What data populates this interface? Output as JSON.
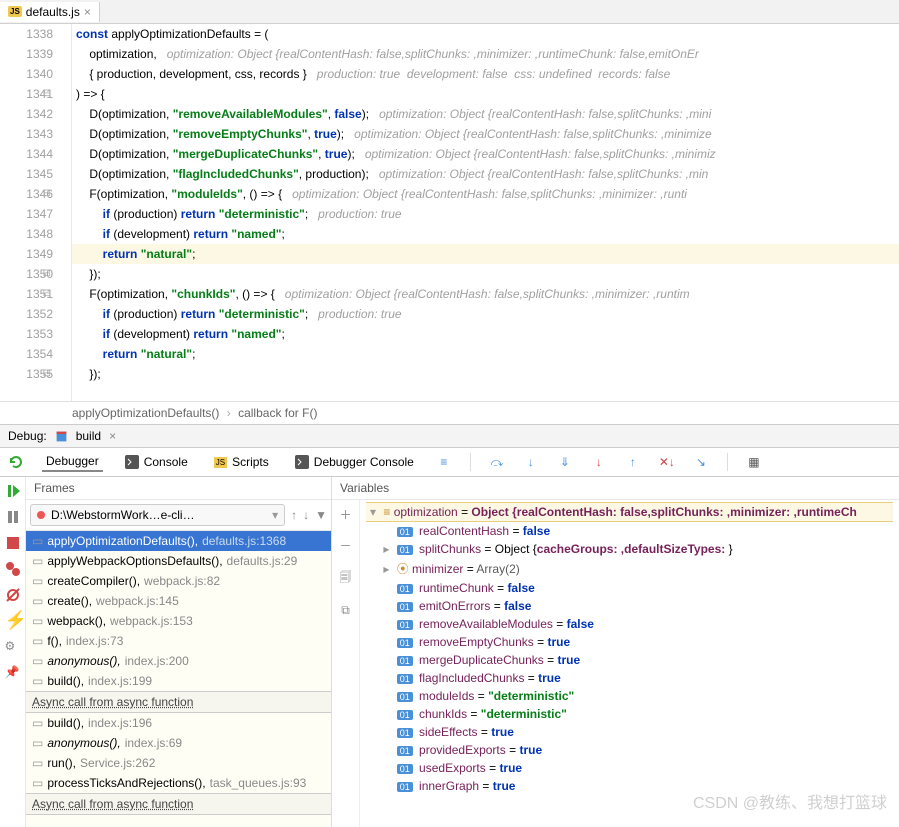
{
  "tab": {
    "label": "defaults.js"
  },
  "lines": [
    {
      "n": 1338,
      "fold": "",
      "html": "<span class='kw'>const</span> applyOptimizationDefaults = ("
    },
    {
      "n": 1339,
      "fold": "",
      "html": "    optimization,   <span class='hint'>optimization: Object {realContentHash: false,splitChunks: ,minimizer: ,runtimeChunk: false,emitOnEr</span>"
    },
    {
      "n": 1340,
      "fold": "",
      "html": "    { production, development, css, records }   <span class='hint'>production: true  development: false  css: undefined  records: false</span>"
    },
    {
      "n": 1341,
      "fold": "⊟",
      "html": ") =&gt; {"
    },
    {
      "n": 1342,
      "fold": "",
      "html": "    D(optimization, <span class='str'>\"removeAvailableModules\"</span>, <span class='lit'>false</span>);   <span class='hint'>optimization: Object {realContentHash: false,splitChunks: ,mini</span>"
    },
    {
      "n": 1343,
      "fold": "",
      "html": "    D(optimization, <span class='str'>\"removeEmptyChunks\"</span>, <span class='lit'>true</span>);   <span class='hint'>optimization: Object {realContentHash: false,splitChunks: ,minimize</span>"
    },
    {
      "n": 1344,
      "fold": "",
      "html": "    D(optimization, <span class='str'>\"mergeDuplicateChunks\"</span>, <span class='lit'>true</span>);   <span class='hint'>optimization: Object {realContentHash: false,splitChunks: ,minimiz</span>"
    },
    {
      "n": 1345,
      "fold": "",
      "html": "    D(optimization, <span class='str'>\"flagIncludedChunks\"</span>, production);   <span class='hint'>optimization: Object {realContentHash: false,splitChunks: ,min</span>"
    },
    {
      "n": 1346,
      "fold": "⊟",
      "html": "    F(optimization, <span class='str'>\"moduleIds\"</span>, () =&gt; {   <span class='hint'>optimization: Object {realContentHash: false,splitChunks: ,minimizer: ,runti</span>"
    },
    {
      "n": 1347,
      "fold": "",
      "html": "        <span class='kw'>if</span> (production) <span class='kw'>return</span> <span class='str'>\"deterministic\"</span>;   <span class='hint'>production: true</span>"
    },
    {
      "n": 1348,
      "fold": "",
      "html": "        <span class='kw'>if</span> (development) <span class='kw'>return</span> <span class='str'>\"named\"</span>;"
    },
    {
      "n": 1349,
      "fold": "",
      "hl": true,
      "html": "        <span class='kw'>return</span> <span class='str'>\"natural\"</span>;"
    },
    {
      "n": 1350,
      "fold": "⊟",
      "html": "    });"
    },
    {
      "n": 1351,
      "fold": "⊟",
      "html": "    F(optimization, <span class='str'>\"chunkIds\"</span>, () =&gt; {   <span class='hint'>optimization: Object {realContentHash: false,splitChunks: ,minimizer: ,runtim</span>"
    },
    {
      "n": 1352,
      "fold": "",
      "html": "        <span class='kw'>if</span> (production) <span class='kw'>return</span> <span class='str'>\"deterministic\"</span>;   <span class='hint'>production: true</span>"
    },
    {
      "n": 1353,
      "fold": "",
      "html": "        <span class='kw'>if</span> (development) <span class='kw'>return</span> <span class='str'>\"named\"</span>;"
    },
    {
      "n": 1354,
      "fold": "",
      "html": "        <span class='kw'>return</span> <span class='str'>\"natural\"</span>;"
    },
    {
      "n": 1355,
      "fold": "⊟",
      "html": "    });"
    }
  ],
  "breadcrumb": {
    "a": "applyOptimizationDefaults()",
    "b": "callback for F()"
  },
  "debug": {
    "label": "Debug:",
    "run": "build"
  },
  "debugTabs": {
    "debugger": "Debugger",
    "console": "Console",
    "scripts": "Scripts",
    "debuggerConsole": "Debugger Console"
  },
  "framesHeader": "Frames",
  "threadSelect": "D:\\WebstormWork…e-cli…",
  "frames": [
    {
      "sel": true,
      "fn": "applyOptimizationDefaults()",
      "loc": "defaults.js:1368"
    },
    {
      "fn": "applyWebpackOptionsDefaults()",
      "loc": "defaults.js:29"
    },
    {
      "fn": "createCompiler()",
      "loc": "webpack.js:82"
    },
    {
      "fn": "create()",
      "loc": "webpack.js:145"
    },
    {
      "fn": "webpack()",
      "loc": "webpack.js:153"
    },
    {
      "fn": "f()",
      "loc": "index.js:73"
    },
    {
      "fn": "anonymous()",
      "loc": "index.js:200",
      "it": true
    },
    {
      "fn": "build()",
      "loc": "index.js:199"
    },
    {
      "async": "Async call from async function"
    },
    {
      "fn": "build()",
      "loc": "index.js:196"
    },
    {
      "fn": "anonymous()",
      "loc": "index.js:69",
      "it": true
    },
    {
      "fn": "run()",
      "loc": "Service.js:262"
    },
    {
      "fn": "processTicksAndRejections()",
      "loc": "task_queues.js:93"
    },
    {
      "async": "Async call from async function"
    }
  ],
  "varsHeader": "Variables",
  "vars": {
    "top": {
      "name": "optimization",
      "summary": "Object {realContentHash: false,splitChunks: ,minimizer: ,runtimeCh"
    },
    "rows": [
      {
        "k": "realContentHash",
        "t": "bool",
        "v": "false"
      },
      {
        "k": "splitChunks",
        "t": "obj",
        "v": "Object {cacheGroups: ,defaultSizeTypes: }"
      },
      {
        "k": "minimizer",
        "t": "arr",
        "v": "Array(2)"
      },
      {
        "k": "runtimeChunk",
        "t": "bool",
        "v": "false"
      },
      {
        "k": "emitOnErrors",
        "t": "bool",
        "v": "false"
      },
      {
        "k": "removeAvailableModules",
        "t": "bool",
        "v": "false"
      },
      {
        "k": "removeEmptyChunks",
        "t": "bool",
        "v": "true"
      },
      {
        "k": "mergeDuplicateChunks",
        "t": "bool",
        "v": "true"
      },
      {
        "k": "flagIncludedChunks",
        "t": "bool",
        "v": "true"
      },
      {
        "k": "moduleIds",
        "t": "str",
        "v": "\"deterministic\""
      },
      {
        "k": "chunkIds",
        "t": "str",
        "v": "\"deterministic\""
      },
      {
        "k": "sideEffects",
        "t": "bool",
        "v": "true"
      },
      {
        "k": "providedExports",
        "t": "bool",
        "v": "true"
      },
      {
        "k": "usedExports",
        "t": "bool",
        "v": "true"
      },
      {
        "k": "innerGraph",
        "t": "bool",
        "v": "true"
      }
    ]
  },
  "watermark": "CSDN @教练、我想打篮球"
}
